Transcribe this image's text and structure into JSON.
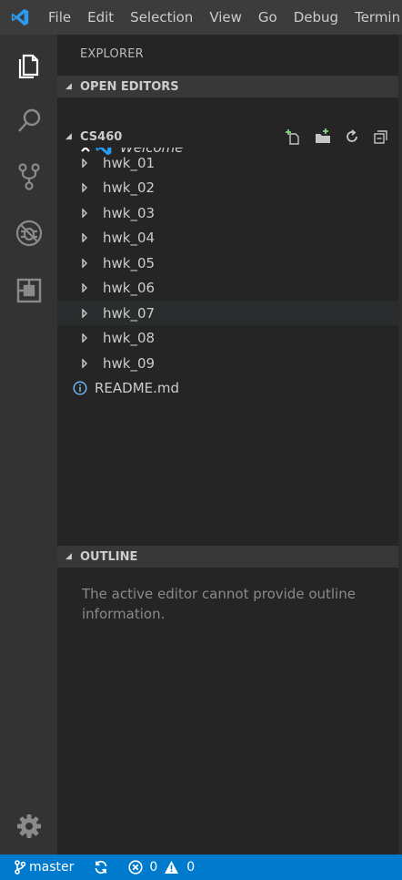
{
  "menu": [
    "File",
    "Edit",
    "Selection",
    "View",
    "Go",
    "Debug",
    "Termin"
  ],
  "sidebar": {
    "title": "EXPLORER",
    "open_editors": {
      "label": "OPEN EDITORS",
      "items": [
        {
          "name": "Welcome"
        }
      ]
    },
    "folder": {
      "label": "CS460",
      "items": [
        {
          "name": "hwk_01",
          "type": "folder"
        },
        {
          "name": "hwk_02",
          "type": "folder"
        },
        {
          "name": "hwk_03",
          "type": "folder"
        },
        {
          "name": "hwk_04",
          "type": "folder"
        },
        {
          "name": "hwk_05",
          "type": "folder"
        },
        {
          "name": "hwk_06",
          "type": "folder"
        },
        {
          "name": "hwk_07",
          "type": "folder"
        },
        {
          "name": "hwk_08",
          "type": "folder"
        },
        {
          "name": "hwk_09",
          "type": "folder"
        },
        {
          "name": "README.md",
          "type": "file"
        }
      ]
    },
    "outline": {
      "label": "OUTLINE",
      "message": "The active editor cannot provide outline information."
    }
  },
  "activity_icons": [
    "explorer-icon",
    "search-icon",
    "source-control-icon",
    "debug-icon",
    "extensions-icon",
    "gear-icon"
  ],
  "status": {
    "branch": "master",
    "errors": "0",
    "warnings": "0"
  },
  "colors": {
    "accent": "#007acc",
    "menubar": "#3c3c3c",
    "activitybar": "#333333",
    "sidebar": "#252526",
    "section_header": "#383838"
  }
}
